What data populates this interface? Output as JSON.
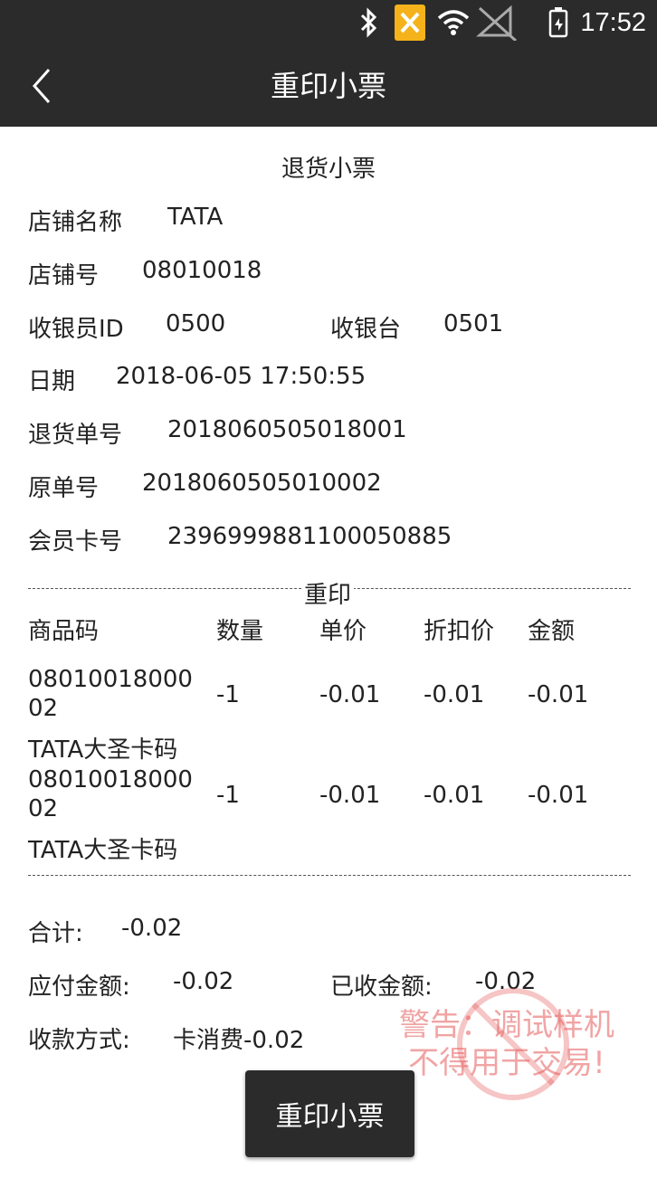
{
  "status_bar": {
    "time": "17:52"
  },
  "app_bar": {
    "title": "重印小票"
  },
  "receipt": {
    "title": "退货小票",
    "store_name_label": "店铺名称",
    "store_name": "TATA",
    "store_no_label": "店铺号",
    "store_no": "08010018",
    "cashier_label": "收银员ID",
    "cashier": "0500",
    "register_label": "收银台",
    "register": "0501",
    "date_label": "日期",
    "date": "2018-06-05 17:50:55",
    "return_no_label": "退货单号",
    "return_no": "2018060505018001",
    "orig_no_label": "原单号",
    "orig_no": "2018060505010002",
    "member_label": "会员卡号",
    "member": "2396999881100050885",
    "reprint_mark": "重印",
    "columns": {
      "code": "商品码",
      "qty": "数量",
      "price": "单价",
      "disc": "折扣价",
      "amount": "金额"
    },
    "items": [
      {
        "code_l1": "08010018000",
        "code_l2": "02",
        "qty": "-1",
        "price": "-0.01",
        "disc": "-0.01",
        "amount": "-0.01",
        "name": "TATA大圣卡码"
      },
      {
        "code_l1": "08010018000",
        "code_l2": "02",
        "qty": "-1",
        "price": "-0.01",
        "disc": "-0.01",
        "amount": "-0.01",
        "name": "TATA大圣卡码"
      }
    ],
    "total_label": "合计:",
    "total": "-0.02",
    "payable_label": "应付金额:",
    "payable": "-0.02",
    "received_label": "已收金额:",
    "received": "-0.02",
    "payment_label": "收款方式:",
    "payment": "卡消费-0.02"
  },
  "button": {
    "label": "重印小票"
  },
  "watermark": {
    "line1": "警告：调试样机",
    "line2": "不得用于交易!"
  }
}
